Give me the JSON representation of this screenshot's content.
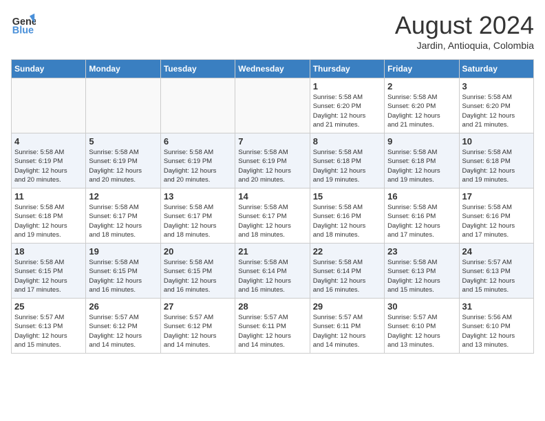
{
  "header": {
    "logo_line1": "General",
    "logo_line2": "Blue",
    "month_title": "August 2024",
    "location": "Jardin, Antioquia, Colombia"
  },
  "weekdays": [
    "Sunday",
    "Monday",
    "Tuesday",
    "Wednesday",
    "Thursday",
    "Friday",
    "Saturday"
  ],
  "weeks": [
    [
      {
        "day": "",
        "info": ""
      },
      {
        "day": "",
        "info": ""
      },
      {
        "day": "",
        "info": ""
      },
      {
        "day": "",
        "info": ""
      },
      {
        "day": "1",
        "info": "Sunrise: 5:58 AM\nSunset: 6:20 PM\nDaylight: 12 hours\nand 21 minutes."
      },
      {
        "day": "2",
        "info": "Sunrise: 5:58 AM\nSunset: 6:20 PM\nDaylight: 12 hours\nand 21 minutes."
      },
      {
        "day": "3",
        "info": "Sunrise: 5:58 AM\nSunset: 6:20 PM\nDaylight: 12 hours\nand 21 minutes."
      }
    ],
    [
      {
        "day": "4",
        "info": "Sunrise: 5:58 AM\nSunset: 6:19 PM\nDaylight: 12 hours\nand 20 minutes."
      },
      {
        "day": "5",
        "info": "Sunrise: 5:58 AM\nSunset: 6:19 PM\nDaylight: 12 hours\nand 20 minutes."
      },
      {
        "day": "6",
        "info": "Sunrise: 5:58 AM\nSunset: 6:19 PM\nDaylight: 12 hours\nand 20 minutes."
      },
      {
        "day": "7",
        "info": "Sunrise: 5:58 AM\nSunset: 6:19 PM\nDaylight: 12 hours\nand 20 minutes."
      },
      {
        "day": "8",
        "info": "Sunrise: 5:58 AM\nSunset: 6:18 PM\nDaylight: 12 hours\nand 19 minutes."
      },
      {
        "day": "9",
        "info": "Sunrise: 5:58 AM\nSunset: 6:18 PM\nDaylight: 12 hours\nand 19 minutes."
      },
      {
        "day": "10",
        "info": "Sunrise: 5:58 AM\nSunset: 6:18 PM\nDaylight: 12 hours\nand 19 minutes."
      }
    ],
    [
      {
        "day": "11",
        "info": "Sunrise: 5:58 AM\nSunset: 6:18 PM\nDaylight: 12 hours\nand 19 minutes."
      },
      {
        "day": "12",
        "info": "Sunrise: 5:58 AM\nSunset: 6:17 PM\nDaylight: 12 hours\nand 18 minutes."
      },
      {
        "day": "13",
        "info": "Sunrise: 5:58 AM\nSunset: 6:17 PM\nDaylight: 12 hours\nand 18 minutes."
      },
      {
        "day": "14",
        "info": "Sunrise: 5:58 AM\nSunset: 6:17 PM\nDaylight: 12 hours\nand 18 minutes."
      },
      {
        "day": "15",
        "info": "Sunrise: 5:58 AM\nSunset: 6:16 PM\nDaylight: 12 hours\nand 18 minutes."
      },
      {
        "day": "16",
        "info": "Sunrise: 5:58 AM\nSunset: 6:16 PM\nDaylight: 12 hours\nand 17 minutes."
      },
      {
        "day": "17",
        "info": "Sunrise: 5:58 AM\nSunset: 6:16 PM\nDaylight: 12 hours\nand 17 minutes."
      }
    ],
    [
      {
        "day": "18",
        "info": "Sunrise: 5:58 AM\nSunset: 6:15 PM\nDaylight: 12 hours\nand 17 minutes."
      },
      {
        "day": "19",
        "info": "Sunrise: 5:58 AM\nSunset: 6:15 PM\nDaylight: 12 hours\nand 16 minutes."
      },
      {
        "day": "20",
        "info": "Sunrise: 5:58 AM\nSunset: 6:15 PM\nDaylight: 12 hours\nand 16 minutes."
      },
      {
        "day": "21",
        "info": "Sunrise: 5:58 AM\nSunset: 6:14 PM\nDaylight: 12 hours\nand 16 minutes."
      },
      {
        "day": "22",
        "info": "Sunrise: 5:58 AM\nSunset: 6:14 PM\nDaylight: 12 hours\nand 16 minutes."
      },
      {
        "day": "23",
        "info": "Sunrise: 5:58 AM\nSunset: 6:13 PM\nDaylight: 12 hours\nand 15 minutes."
      },
      {
        "day": "24",
        "info": "Sunrise: 5:57 AM\nSunset: 6:13 PM\nDaylight: 12 hours\nand 15 minutes."
      }
    ],
    [
      {
        "day": "25",
        "info": "Sunrise: 5:57 AM\nSunset: 6:13 PM\nDaylight: 12 hours\nand 15 minutes."
      },
      {
        "day": "26",
        "info": "Sunrise: 5:57 AM\nSunset: 6:12 PM\nDaylight: 12 hours\nand 14 minutes."
      },
      {
        "day": "27",
        "info": "Sunrise: 5:57 AM\nSunset: 6:12 PM\nDaylight: 12 hours\nand 14 minutes."
      },
      {
        "day": "28",
        "info": "Sunrise: 5:57 AM\nSunset: 6:11 PM\nDaylight: 12 hours\nand 14 minutes."
      },
      {
        "day": "29",
        "info": "Sunrise: 5:57 AM\nSunset: 6:11 PM\nDaylight: 12 hours\nand 14 minutes."
      },
      {
        "day": "30",
        "info": "Sunrise: 5:57 AM\nSunset: 6:10 PM\nDaylight: 12 hours\nand 13 minutes."
      },
      {
        "day": "31",
        "info": "Sunrise: 5:56 AM\nSunset: 6:10 PM\nDaylight: 12 hours\nand 13 minutes."
      }
    ]
  ]
}
